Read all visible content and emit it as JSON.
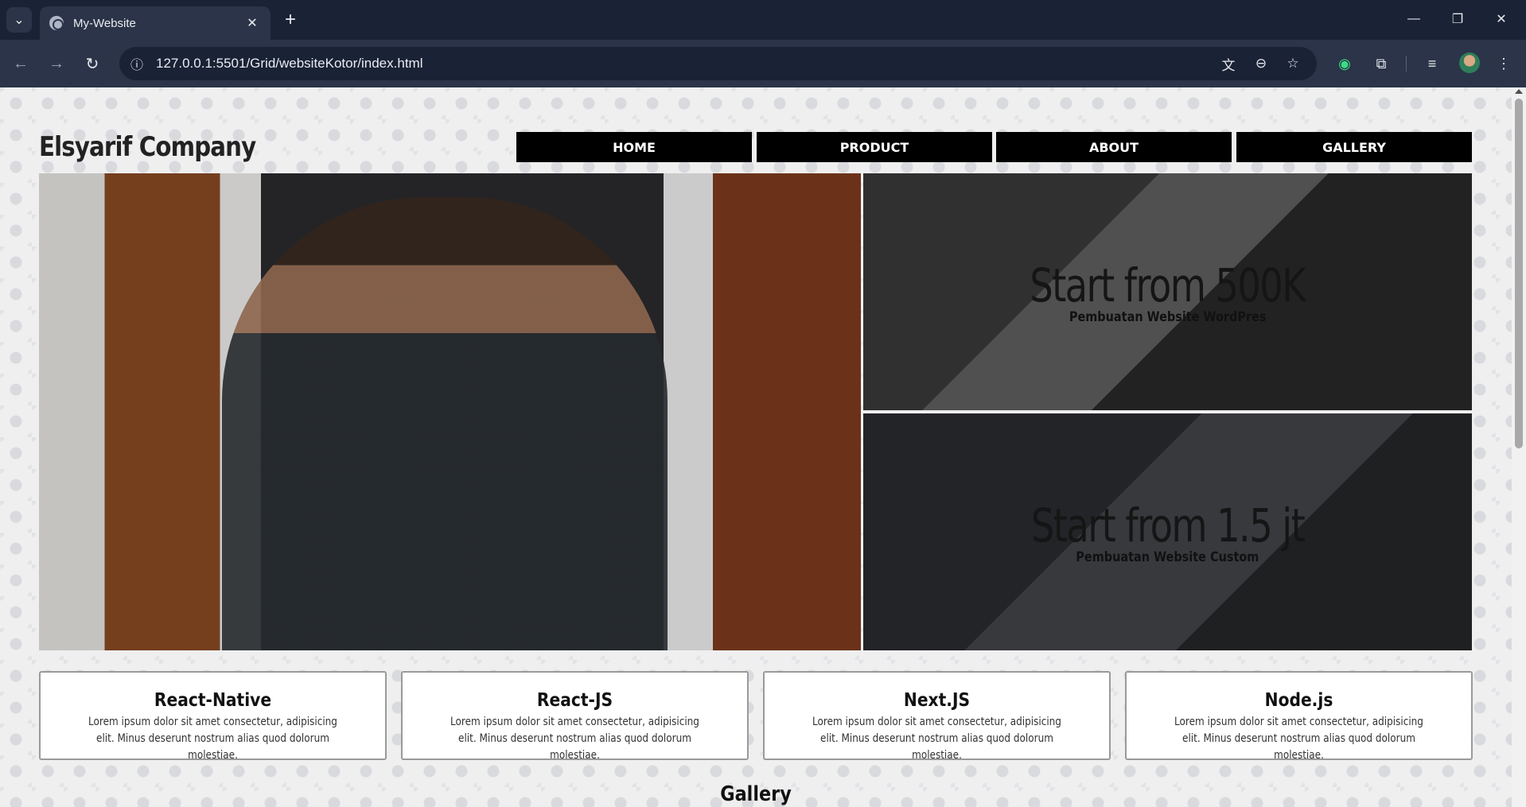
{
  "browser": {
    "tab_title": "My-Website",
    "url": "127.0.0.1:5501/Grid/websiteKotor/index.html"
  },
  "site": {
    "brand": "Elsyarif Company",
    "nav": [
      "HOME",
      "PRODUCT",
      "ABOUT",
      "GALLERY"
    ],
    "promos": [
      {
        "price": "Start from 500K",
        "subtitle": "Pembuatan Website WordPres"
      },
      {
        "price": "Start from 1.5 jt",
        "subtitle": "Pembuatan Website Custom"
      }
    ],
    "cards": [
      {
        "title": "React-Native",
        "text": "Lorem ipsum dolor sit amet consectetur, adipisicing elit. Minus deserunt nostrum alias quod dolorum molestiae."
      },
      {
        "title": "React-JS",
        "text": "Lorem ipsum dolor sit amet consectetur, adipisicing elit. Minus deserunt nostrum alias quod dolorum molestiae."
      },
      {
        "title": "Next.JS",
        "text": "Lorem ipsum dolor sit amet consectetur, adipisicing elit. Minus deserunt nostrum alias quod dolorum molestiae."
      },
      {
        "title": "Node.js",
        "text": "Lorem ipsum dolor sit amet consectetur, adipisicing elit. Minus deserunt nostrum alias quod dolorum molestiae."
      }
    ],
    "gallery_heading": "Gallery"
  }
}
